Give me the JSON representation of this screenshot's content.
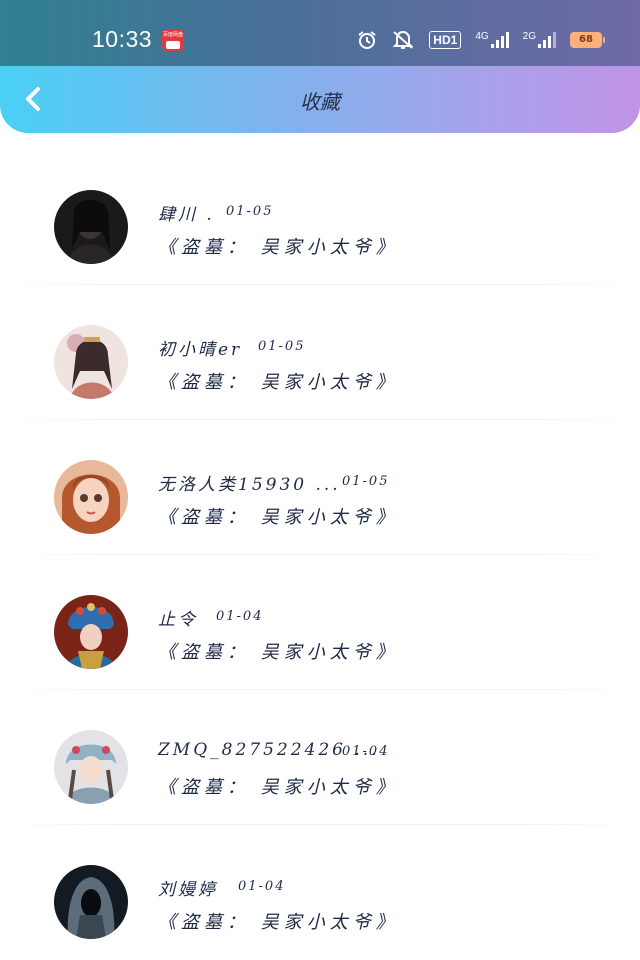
{
  "status_bar": {
    "time": "10:33",
    "app_icon_label": "百度网盘",
    "icons": [
      "alarm-icon",
      "mute-icon",
      "hd-icon",
      "signal-4g-icon",
      "signal-2g-icon",
      "battery-icon"
    ],
    "hd_label": "HD1",
    "net1_label": "4G",
    "net2_label": "2G",
    "battery_level": "68"
  },
  "nav": {
    "back_icon": "chevron-left-icon",
    "title": "收藏"
  },
  "favorites": [
    {
      "name": "肆川 .",
      "date": "01-05",
      "title": "《盗墓： 吴家小太爷》",
      "avatar": "dark-portrait"
    },
    {
      "name": "初小晴er",
      "date": "01-05",
      "title": "《盗墓： 吴家小太爷》",
      "avatar": "hanfu-girl"
    },
    {
      "name": "无洛人类15930 ...",
      "date": "01-05",
      "title": "《盗墓： 吴家小太爷》",
      "avatar": "doll-girl"
    },
    {
      "name": "止令",
      "date": "01-04",
      "title": "《盗墓： 吴家小太爷》",
      "avatar": "opera-figure"
    },
    {
      "name": "ZMQ_827522426 ...",
      "date": "01-04",
      "title": "《盗墓： 吴家小太爷》",
      "avatar": "painted-girl"
    },
    {
      "name": "刘嫚婷",
      "date": "01-04",
      "title": "《盗墓： 吴家小太爷》",
      "avatar": "hooded-figure"
    }
  ],
  "colors": {
    "status_bar_start": "#2f8090",
    "nav_start": "#4ad0f4",
    "nav_end": "#c093e6",
    "text": "#1f2a48"
  }
}
